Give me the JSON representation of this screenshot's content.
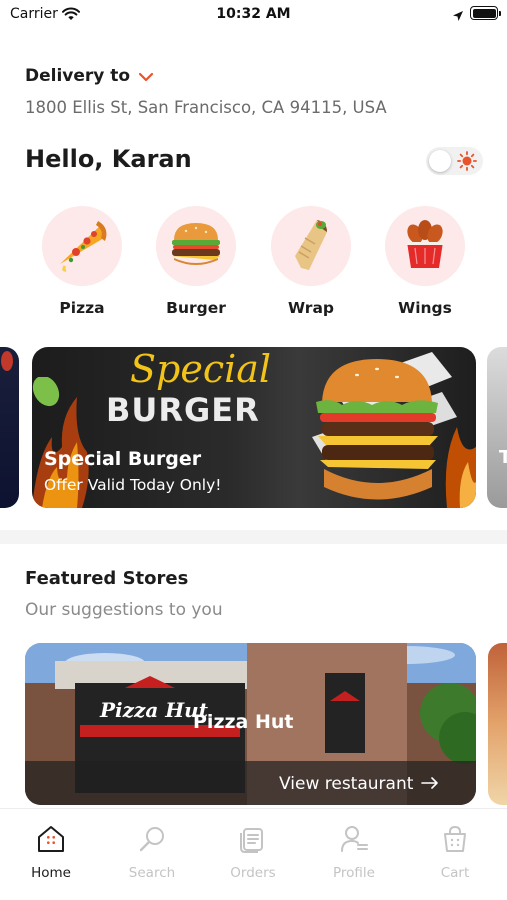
{
  "status_bar": {
    "carrier": "Carrier",
    "time": "10:32 AM"
  },
  "delivery": {
    "label": "Delivery to",
    "address": "1800 Ellis St, San Francisco, CA 94115, USA"
  },
  "greeting": "Hello, Karan",
  "categories": [
    {
      "label": "Pizza",
      "icon": "pizza-icon"
    },
    {
      "label": "Burger",
      "icon": "burger-icon"
    },
    {
      "label": "Wrap",
      "icon": "wrap-icon"
    },
    {
      "label": "Wings",
      "icon": "wings-icon"
    }
  ],
  "promo": {
    "script_text": "Special",
    "headline": "BURGER",
    "title": "Special Burger",
    "subtitle": "Offer Valid Today Only!"
  },
  "featured": {
    "title": "Featured Stores",
    "subtitle": "Our suggestions to you",
    "stores": [
      {
        "name": "Pizza Hut",
        "sign": "Pizza Hut",
        "action": "View restaurant"
      }
    ]
  },
  "tabs": [
    {
      "label": "Home",
      "icon": "home-icon",
      "active": true
    },
    {
      "label": "Search",
      "icon": "search-icon",
      "active": false
    },
    {
      "label": "Orders",
      "icon": "orders-icon",
      "active": false
    },
    {
      "label": "Profile",
      "icon": "profile-icon",
      "active": false
    },
    {
      "label": "Cart",
      "icon": "cart-icon",
      "active": false
    }
  ],
  "colors": {
    "accent": "#e8542c",
    "category_bg": "#fde8ea",
    "text_primary": "#1c1c1c",
    "text_secondary": "#6b6b6b",
    "tab_inactive": "#c4c4c4"
  }
}
